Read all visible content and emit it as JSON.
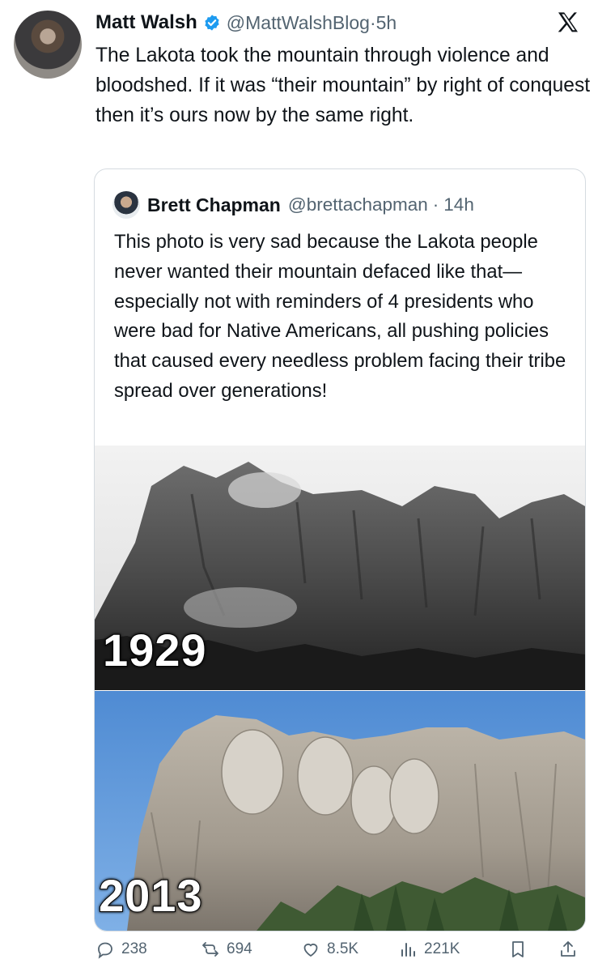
{
  "tweet": {
    "author_name": "Matt Walsh",
    "author_handle": "@MattWalshBlog",
    "time": "5h",
    "text": "The Lakota took the mountain through violence and bloodshed. If it was “their mountain” by right of conquest then it’s ours now by the same right."
  },
  "quoted_tweet": {
    "author_name": "Brett Chapman",
    "author_handle": "@brettachapman",
    "time": "14h",
    "text": "This photo is very sad because the Lakota people never wanted their mountain defaced like that—especially not with reminders of 4 presidents who were bad for Native Americans, all pushing policies that caused every needless problem facing their tribe spread over generations!",
    "images": [
      {
        "year_label": "1929"
      },
      {
        "year_label": "2013"
      }
    ]
  },
  "actions": {
    "replies": "238",
    "reposts": "694",
    "likes": "8.5K",
    "views": "221K"
  },
  "colors": {
    "verified_blue": "#1d9bf0",
    "secondary_text": "#536471",
    "sky_blue": "#5b94d6"
  },
  "icons": [
    "x-logo-icon",
    "verified-badge-icon",
    "reply-icon",
    "repost-icon",
    "like-icon",
    "views-icon",
    "bookmark-icon",
    "share-icon"
  ]
}
